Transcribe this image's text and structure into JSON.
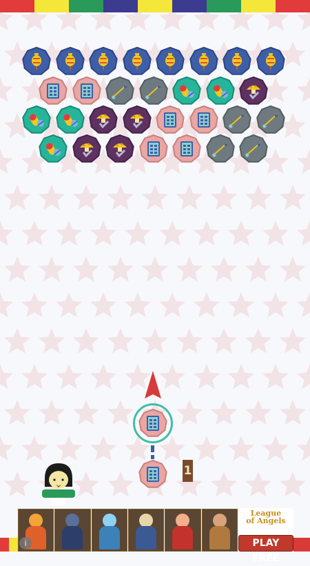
{
  "topbar_colors": [
    "#e23b3b",
    "#f5e63a",
    "#2a9a5b",
    "#3b3b8f",
    "#f5e63a",
    "#3b3b8f",
    "#2a9a5b",
    "#f5e63a",
    "#e23b3b"
  ],
  "bubble_types": {
    "blue": {
      "fill": "#3f5ea8",
      "stroke": "#2b4585",
      "icon": "lantern-icon"
    },
    "pink": {
      "fill": "#e9a6a3",
      "stroke": "#c9807c",
      "icon": "calendar-icon"
    },
    "grey": {
      "fill": "#6f7a80",
      "stroke": "#525c61",
      "icon": "broom-icon"
    },
    "green": {
      "fill": "#26b59a",
      "stroke": "#178a74",
      "icon": "pill-icon"
    },
    "purple": {
      "fill": "#5e3160",
      "stroke": "#43214a",
      "icon": "mushroom-icon"
    }
  },
  "grid": [
    [
      "blue",
      "blue",
      "blue",
      "blue",
      "blue",
      "blue",
      "blue",
      "blue"
    ],
    [
      "pink",
      "pink",
      "grey",
      "grey",
      "green",
      "green",
      "purple"
    ],
    [
      "green",
      "green",
      "purple",
      "purple",
      "pink",
      "pink",
      "grey",
      "grey"
    ],
    [
      "green",
      "purple",
      "purple",
      "pink",
      "pink",
      "grey",
      "grey"
    ]
  ],
  "shooter": {
    "current": "pink",
    "next": "pink"
  },
  "counter": {
    "value": "1"
  },
  "ad": {
    "logo_line1": "League",
    "logo_line2": "of Angels",
    "play_label": "PLAY FREE",
    "info_label": "i"
  }
}
